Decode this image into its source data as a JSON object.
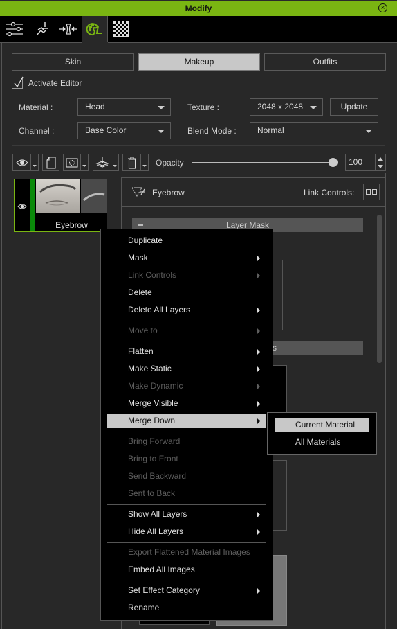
{
  "window": {
    "title": "Modify",
    "close_icon": "circle-x-icon"
  },
  "toolbar": {
    "tools": [
      {
        "name": "sliders-icon",
        "active": false
      },
      {
        "name": "motion-icon",
        "active": false
      },
      {
        "name": "morph-icon",
        "active": false
      },
      {
        "name": "appearance-editor-icon",
        "active": true
      },
      {
        "name": "checker-texture-icon",
        "active": false
      }
    ]
  },
  "segments": [
    {
      "label": "Skin",
      "active": false
    },
    {
      "label": "Makeup",
      "active": true
    },
    {
      "label": "Outfits",
      "active": false
    }
  ],
  "activate_editor": {
    "label": "Activate Editor",
    "checked": true
  },
  "fields": {
    "material": {
      "label": "Material :",
      "value": "Head"
    },
    "texture": {
      "label": "Texture :",
      "value": "2048 x 2048"
    },
    "update_button": "Update",
    "channel": {
      "label": "Channel :",
      "value": "Base Color"
    },
    "blend_mode": {
      "label": "Blend Mode :",
      "value": "Normal"
    }
  },
  "layer_toolbar": {
    "buttons": [
      "eye-icon",
      "new-layer-icon",
      "mask-icon",
      "layers-stack-icon",
      "trash-icon"
    ],
    "opacity_label": "Opacity",
    "opacity_value": "100",
    "opacity_percent": 100
  },
  "layers": [
    {
      "name": "Eyebrow",
      "visible": true,
      "selected": true
    }
  ],
  "detail": {
    "layer_name": "Eyebrow",
    "link_controls_label": "Link Controls:",
    "mask_header": "Layer Mask",
    "section2_header_suffix": "s"
  },
  "context_menu": {
    "items": [
      {
        "label": "Duplicate",
        "disabled": false,
        "submenu": false
      },
      {
        "label": "Mask",
        "disabled": false,
        "submenu": true
      },
      {
        "label": "Link Controls",
        "disabled": true,
        "submenu": true
      },
      {
        "label": "Delete",
        "disabled": false,
        "submenu": false
      },
      {
        "label": "Delete All Layers",
        "disabled": false,
        "submenu": true
      },
      {
        "separator": true
      },
      {
        "label": "Move to",
        "disabled": true,
        "submenu": true
      },
      {
        "separator": true
      },
      {
        "label": "Flatten",
        "disabled": false,
        "submenu": true
      },
      {
        "label": "Make Static",
        "disabled": false,
        "submenu": true
      },
      {
        "label": "Make Dynamic",
        "disabled": true,
        "submenu": true
      },
      {
        "label": "Merge Visible",
        "disabled": false,
        "submenu": true
      },
      {
        "label": "Merge Down",
        "disabled": false,
        "submenu": true,
        "highlighted": true
      },
      {
        "separator": true
      },
      {
        "label": "Bring Forward",
        "disabled": true,
        "submenu": false
      },
      {
        "label": "Bring to Front",
        "disabled": true,
        "submenu": false
      },
      {
        "label": "Send Backward",
        "disabled": true,
        "submenu": false
      },
      {
        "label": "Sent to Back",
        "disabled": true,
        "submenu": false
      },
      {
        "separator": true
      },
      {
        "label": "Show All Layers",
        "disabled": false,
        "submenu": true
      },
      {
        "label": "Hide All Layers",
        "disabled": false,
        "submenu": true
      },
      {
        "separator": true
      },
      {
        "label": "Export Flattened Material Images",
        "disabled": true,
        "submenu": false
      },
      {
        "label": "Embed All Images",
        "disabled": false,
        "submenu": false
      },
      {
        "separator": true
      },
      {
        "label": "Set Effect Category",
        "disabled": false,
        "submenu": true
      },
      {
        "label": "Rename",
        "disabled": false,
        "submenu": false
      }
    ]
  },
  "submenu": {
    "items": [
      {
        "label": "Current Material",
        "highlighted": true
      },
      {
        "label": "All Materials",
        "highlighted": false
      }
    ]
  },
  "colors": {
    "accent": "#7ab512",
    "layer_color_tag": "#0a8a0a",
    "highlight": "#c8c8c8",
    "background": "#282828"
  }
}
